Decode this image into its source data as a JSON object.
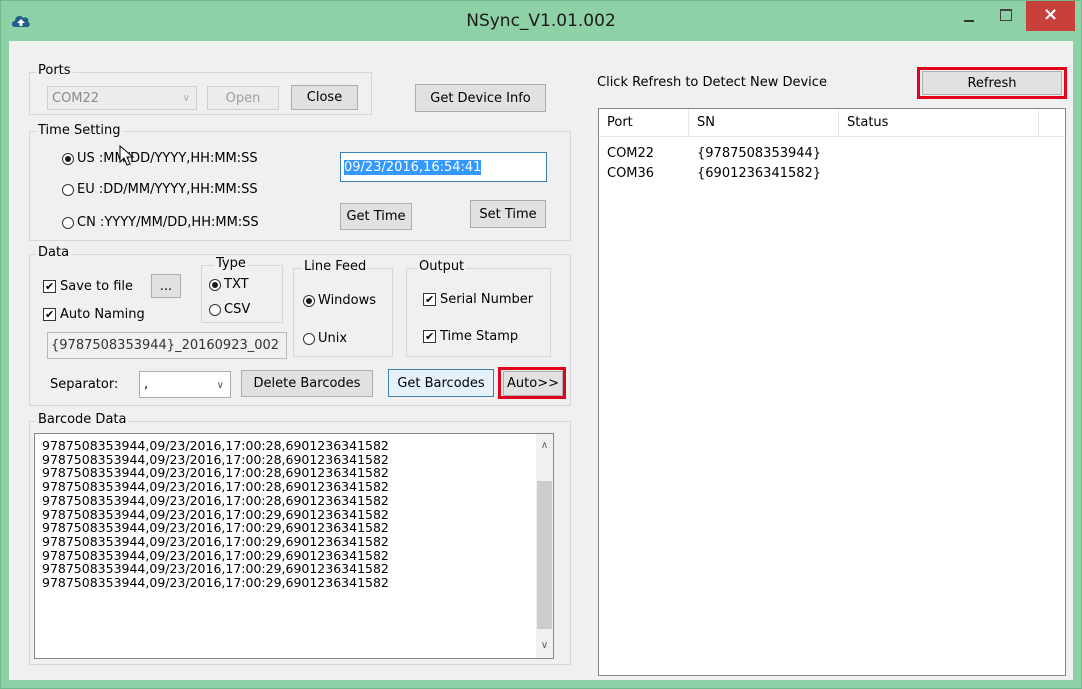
{
  "window": {
    "title": "NSync_V1.01.002",
    "close_glyph": "×",
    "app_icon": "cloud-upload-icon",
    "accent": "#8ed1a6",
    "close_color": "#c7403a"
  },
  "ports": {
    "label": "Ports",
    "selected_port": "COM22",
    "open_label": "Open",
    "close_label": "Close",
    "device_info_label": "Get Device Info"
  },
  "time_setting": {
    "label": "Time Setting",
    "us_label": "US :MM/DD/YYYY,HH:MM:SS",
    "eu_label": "EU :DD/MM/YYYY,HH:MM:SS",
    "cn_label": "CN :YYYY/MM/DD,HH:MM:SS",
    "selected_format": "US",
    "datetime_value": "09/23/2016,16:54:41",
    "get_time_label": "Get Time",
    "set_time_label": "Set Time"
  },
  "data": {
    "label": "Data",
    "save_to_file_label": "Save to file",
    "browse_label": "...",
    "auto_naming_label": "Auto Naming",
    "save_to_file_checked": true,
    "auto_naming_checked": true,
    "file_name": "{9787508353944}_20160923_002",
    "type_label": "Type",
    "type_txt_label": "TXT",
    "type_csv_label": "CSV",
    "type_selected": "TXT",
    "line_feed_label": "Line Feed",
    "windows_label": "Windows",
    "unix_label": "Unix",
    "line_feed_selected": "Windows",
    "output_label": "Output",
    "serial_number_label": "Serial Number",
    "time_stamp_label": "Time Stamp",
    "serial_number_checked": true,
    "time_stamp_checked": true,
    "separator_label": "Separator:",
    "separator_value": ",",
    "delete_barcodes_label": "Delete Barcodes",
    "get_barcodes_label": "Get Barcodes",
    "auto_label": "Auto>>"
  },
  "barcode_data": {
    "label": "Barcode Data",
    "lines": [
      "9787508353944,09/23/2016,17:00:28,6901236341582",
      "9787508353944,09/23/2016,17:00:28,6901236341582",
      "9787508353944,09/23/2016,17:00:28,6901236341582",
      "9787508353944,09/23/2016,17:00:28,6901236341582",
      "9787508353944,09/23/2016,17:00:28,6901236341582",
      "9787508353944,09/23/2016,17:00:29,6901236341582",
      "9787508353944,09/23/2016,17:00:29,6901236341582",
      "9787508353944,09/23/2016,17:00:29,6901236341582",
      "9787508353944,09/23/2016,17:00:29,6901236341582",
      "9787508353944,09/23/2016,17:00:29,6901236341582",
      "9787508353944,09/23/2016,17:00:29,6901236341582"
    ]
  },
  "devices": {
    "hint": "Click Refresh to Detect New Device",
    "refresh_label": "Refresh",
    "columns": [
      "Port",
      "SN",
      "Status"
    ],
    "rows": [
      {
        "port": "COM22",
        "sn": "{9787508353944}",
        "status": ""
      },
      {
        "port": "COM36",
        "sn": "{6901236341582}",
        "status": ""
      }
    ]
  },
  "highlight_color": "#e2001a"
}
